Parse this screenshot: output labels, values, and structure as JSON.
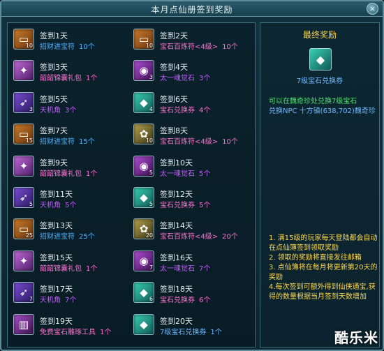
{
  "window": {
    "title": "本月点仙册签到奖励",
    "close_label": "×"
  },
  "colors": {
    "day_label": "#e8eef0",
    "yellow": "#ffd84a",
    "orange": "#f0a640",
    "blue": "#4fb3ff",
    "purple": "#c45cff",
    "pink": "#ff6fd0",
    "green": "#4fe06a",
    "teal_blue": "#6fb7ff"
  },
  "days": [
    {
      "label": "签到1天",
      "reward": "招财进宝符",
      "count": "10个",
      "color": "#4fb3ff",
      "icon": "ic-token",
      "glyph": "▭",
      "qty": "10"
    },
    {
      "label": "签到2天",
      "reward": "宝石百炼符<4级>",
      "count": "10个",
      "color": "#ff6fd0",
      "icon": "ic-token",
      "glyph": "▭",
      "qty": "10"
    },
    {
      "label": "签到3天",
      "reward": "韶韶锦囊礼包",
      "count": "1个",
      "color": "#ff6fd0",
      "icon": "ic-gift",
      "glyph": "✦",
      "qty": ""
    },
    {
      "label": "签到4天",
      "reward": "太一魂觉石",
      "count": "3个",
      "color": "#c45cff",
      "icon": "ic-soul",
      "glyph": "◉",
      "qty": "3"
    },
    {
      "label": "签到5天",
      "reward": "天机角",
      "count": "3个",
      "color": "#c45cff",
      "icon": "ic-horn",
      "glyph": "➶",
      "qty": "3"
    },
    {
      "label": "签到6天",
      "reward": "宝石兑换券",
      "count": "4个",
      "color": "#ff6fd0",
      "icon": "ic-coupon",
      "glyph": "◆",
      "qty": "4"
    },
    {
      "label": "签到7天",
      "reward": "招财进宝符",
      "count": "15个",
      "color": "#4fb3ff",
      "icon": "ic-token",
      "glyph": "▭",
      "qty": "15"
    },
    {
      "label": "签到8天",
      "reward": "宝石百炼符<4级>",
      "count": "10个",
      "color": "#ff6fd0",
      "icon": "ic-stone",
      "glyph": "✿",
      "qty": "10"
    },
    {
      "label": "签到9天",
      "reward": "韶韶锦囊礼包",
      "count": "1个",
      "color": "#ff6fd0",
      "icon": "ic-gift",
      "glyph": "✦",
      "qty": ""
    },
    {
      "label": "签到10天",
      "reward": "太一魂觉石",
      "count": "5个",
      "color": "#c45cff",
      "icon": "ic-soul",
      "glyph": "◉",
      "qty": "5"
    },
    {
      "label": "签到11天",
      "reward": "天机角",
      "count": "5个",
      "color": "#c45cff",
      "icon": "ic-horn",
      "glyph": "➶",
      "qty": "5"
    },
    {
      "label": "签到12天",
      "reward": "宝石兑换券",
      "count": "5个",
      "color": "#ff6fd0",
      "icon": "ic-coupon",
      "glyph": "◆",
      "qty": "5"
    },
    {
      "label": "签到13天",
      "reward": "招财进宝符",
      "count": "25个",
      "color": "#4fb3ff",
      "icon": "ic-token",
      "glyph": "▭",
      "qty": "25"
    },
    {
      "label": "签到14天",
      "reward": "宝石百炼符<4级>",
      "count": "20个",
      "color": "#ff6fd0",
      "icon": "ic-stone",
      "glyph": "✿",
      "qty": "20"
    },
    {
      "label": "签到15天",
      "reward": "韶韶锦囊礼包",
      "count": "1个",
      "color": "#ff6fd0",
      "icon": "ic-gift",
      "glyph": "✦",
      "qty": ""
    },
    {
      "label": "签到16天",
      "reward": "太一魂觉石",
      "count": "7个",
      "color": "#c45cff",
      "icon": "ic-soul",
      "glyph": "◉",
      "qty": "7"
    },
    {
      "label": "签到17天",
      "reward": "天机角",
      "count": "7个",
      "color": "#c45cff",
      "icon": "ic-horn",
      "glyph": "➶",
      "qty": "7"
    },
    {
      "label": "签到18天",
      "reward": "宝石兑换券",
      "count": "6个",
      "color": "#ff6fd0",
      "icon": "ic-coupon",
      "glyph": "◆",
      "qty": "6"
    },
    {
      "label": "签到19天",
      "reward": "免费宝石雕琢工具",
      "count": "1个",
      "color": "#ff6fd0",
      "icon": "ic-tool",
      "glyph": "▥",
      "qty": ""
    },
    {
      "label": "签到20天",
      "reward": "7级宝石兑换券",
      "count": "1个",
      "color": "#6fb7ff",
      "icon": "ic-coupon",
      "glyph": "◆",
      "qty": ""
    }
  ],
  "final": {
    "title": "最终奖励",
    "item_name": "7级宝石兑换券",
    "desc_line1": "可以在魏奇珍处兑换7级宝石",
    "desc_line2": "兑换NPC 十方镇(638,702)魏奇珍"
  },
  "notes": [
    "1. 满15级的玩家每天登陆都会自动在点仙簿签到领取奖励",
    "2. 领取的奖励将直接发往邮箱",
    "3. 点仙簿将在每月将更新第20天的奖励",
    "4.每次签到可额外得到仙侠通宝,获得的数量根据当月签到天数增加"
  ],
  "watermark": "酷乐米"
}
